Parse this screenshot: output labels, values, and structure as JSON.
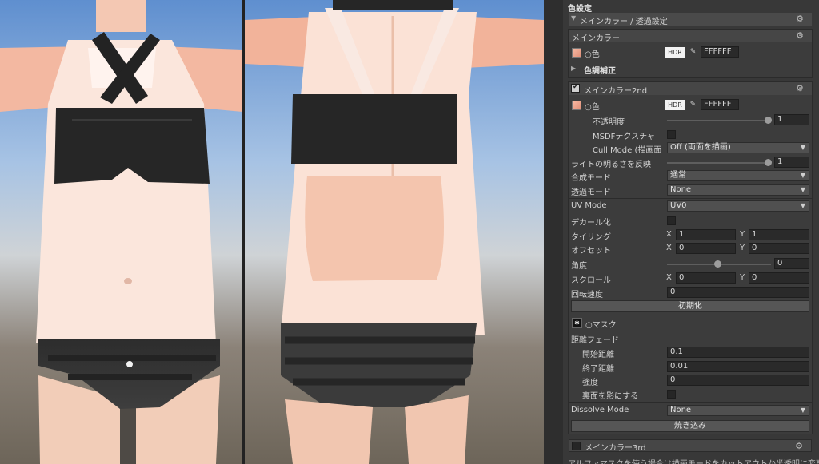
{
  "inspector": {
    "section_title": "色設定",
    "foldout": "メインカラー / 透過設定",
    "main_color": {
      "title": "メインカラー",
      "color_label": "○色",
      "hdr": "HDR",
      "hex": "FFFFFF",
      "color_adjust": "色調補正"
    },
    "main_color2": {
      "title": "メインカラー2nd",
      "enabled": true,
      "color_label": "○色",
      "hdr": "HDR",
      "hex": "FFFFFF",
      "opacity_label": "不透明度",
      "opacity_value": "1",
      "opacity": 1.0,
      "msdf_label": "MSDFテクスチャ",
      "cull_label": "Cull Mode (描画面",
      "cull_value": "Off (両面を描画)",
      "light_label": "ライトの明るさを反映",
      "light_value": "1",
      "light": 1.0,
      "blend_label": "合成モード",
      "blend_value": "通常",
      "alpha_label": "透過モード",
      "alpha_value": "None",
      "uv_label": "UV Mode",
      "uv_value": "UV0",
      "decal_label": "デカール化",
      "tiling_label": "タイリング",
      "tiling_x": "1",
      "tiling_y": "1",
      "offset_label": "オフセット",
      "offset_x": "0",
      "offset_y": "0",
      "angle_label": "角度",
      "angle_value": "0",
      "angle": 0.5,
      "scroll_label": "スクロール",
      "scroll_x": "0",
      "scroll_y": "0",
      "rotate_label": "回転速度",
      "rotate_value": "0",
      "reset_button": "初期化",
      "mask_label": "○マスク",
      "fade_label": "距離フェード",
      "fade_start_label": "開始距離",
      "fade_start": "0.1",
      "fade_end_label": "終了距離",
      "fade_end": "0.01",
      "strength_label": "強度",
      "strength": "0",
      "backface_label": "裏面を影にする",
      "dissolve_label": "Dissolve Mode",
      "dissolve_value": "None",
      "bake_button": "焼き込み"
    },
    "main_color3": {
      "title": "メインカラー3rd",
      "enabled": false
    },
    "x_label": "X",
    "y_label": "Y",
    "footer_text": "アルファマスクを使う場合は描画モードをカットアウトか半透明に変更する"
  },
  "colors": {
    "panel_bg": "#383838",
    "sky": "#6f9bd1",
    "skin": "#f3c2aa",
    "cloth": "#262626"
  }
}
